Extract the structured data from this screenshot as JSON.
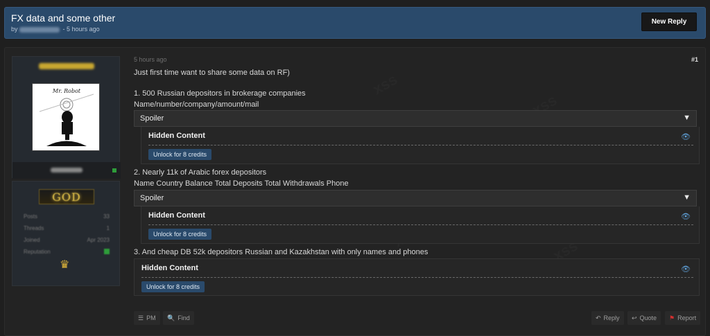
{
  "thread": {
    "title": "FX data and some other",
    "meta_by": "by",
    "meta_time": "- 5 hours ago",
    "new_reply_label": "New Reply"
  },
  "sidebar": {
    "rank_badge": "GOD",
    "stats": [
      {
        "label": "Posts",
        "value": "33"
      },
      {
        "label": "Threads",
        "value": "1"
      },
      {
        "label": "Joined",
        "value": "Apr 2023"
      },
      {
        "label": "Reputation",
        "value": ""
      }
    ],
    "online_color": "#2e9d3a"
  },
  "post": {
    "time": "5 hours ago",
    "number": "#1",
    "intro": "Just first time want to share some data on RF)",
    "section1_title": "1. 500 Russian depositors in brokerage companies",
    "section1_fields": "Name/number/company/amount/mail",
    "spoiler1_label": "Spoiler",
    "hidden1_title": "Hidden Content",
    "unlock1_label": "Unlock for 8 credits",
    "section2_title": "2. Nearly 11k of Arabic forex depositors",
    "section2_fields": "Name Country Balance Total Deposits Total Withdrawals Phone",
    "spoiler2_label": "Spoiler",
    "hidden2_title": "Hidden Content",
    "unlock2_label": "Unlock for 8 credits",
    "section3_title": "3. And cheap DB 52k depositors Russian and Kazakhstan with only names and phones",
    "hidden3_title": "Hidden Content",
    "unlock3_label": "Unlock for 8 credits"
  },
  "footer": {
    "pm_label": "PM",
    "find_label": "Find",
    "reply_label": "Reply",
    "quote_label": "Quote",
    "report_label": "Report"
  },
  "colors": {
    "accent": "#2a4a6b",
    "background": "#1f1f1f",
    "report_icon": "#d32f2f"
  },
  "icons": [
    "chevron-down-icon",
    "eye-icon",
    "pm-icon",
    "search-icon",
    "reply-icon",
    "quote-icon",
    "flag-icon",
    "crown-icon"
  ]
}
